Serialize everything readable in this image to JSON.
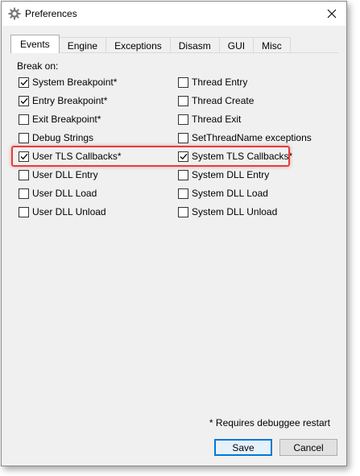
{
  "window": {
    "title": "Preferences",
    "icon": "gear-icon"
  },
  "tabs": [
    {
      "label": "Events",
      "active": true
    },
    {
      "label": "Engine",
      "active": false
    },
    {
      "label": "Exceptions",
      "active": false
    },
    {
      "label": "Disasm",
      "active": false
    },
    {
      "label": "GUI",
      "active": false
    },
    {
      "label": "Misc",
      "active": false
    }
  ],
  "events": {
    "heading": "Break on:",
    "left": [
      {
        "label": "System Breakpoint*",
        "checked": true
      },
      {
        "label": "Entry Breakpoint*",
        "checked": true
      },
      {
        "label": "Exit Breakpoint*",
        "checked": false
      },
      {
        "label": "Debug Strings",
        "checked": false
      },
      {
        "label": "User TLS Callbacks*",
        "checked": true
      },
      {
        "label": "User DLL Entry",
        "checked": false
      },
      {
        "label": "User DLL Load",
        "checked": false
      },
      {
        "label": "User DLL Unload",
        "checked": false
      }
    ],
    "right": [
      {
        "label": "Thread Entry",
        "checked": false
      },
      {
        "label": "Thread Create",
        "checked": false
      },
      {
        "label": "Thread Exit",
        "checked": false
      },
      {
        "label": "SetThreadName exceptions",
        "checked": false
      },
      {
        "label": "System TLS Callbacks*",
        "checked": true
      },
      {
        "label": "System DLL Entry",
        "checked": false
      },
      {
        "label": "System DLL Load",
        "checked": false
      },
      {
        "label": "System DLL Unload",
        "checked": false
      }
    ]
  },
  "footer": {
    "note": "* Requires debuggee restart",
    "save_label": "Save",
    "cancel_label": "Cancel"
  },
  "colors": {
    "highlight": "#e2403f",
    "focus": "#0078d7"
  }
}
